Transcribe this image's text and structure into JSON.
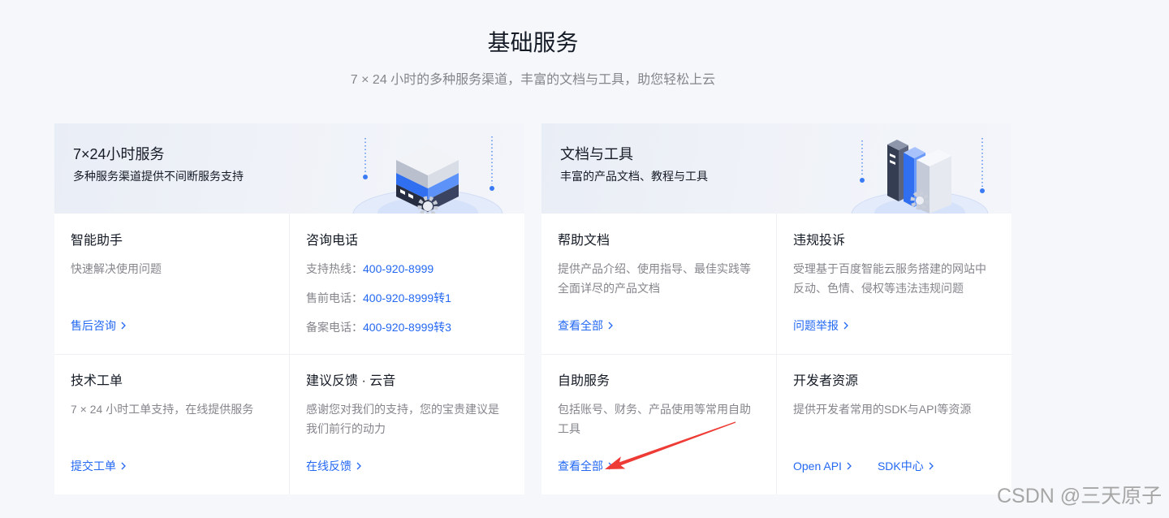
{
  "section": {
    "title": "基础服务",
    "subtitle": "7 × 24 小时的多种服务渠道，丰富的文档与工具，助您轻松上云"
  },
  "panels": [
    {
      "title": "7×24小时服务",
      "subtitle": "多种服务渠道提供不间断服务支持",
      "illustration": "server-stack-illustration",
      "cards": [
        {
          "title": "智能助手",
          "desc": "快速解决使用问题",
          "link": "售后咨询"
        },
        {
          "title": "咨询电话",
          "phones": [
            {
              "label": "支持热线：",
              "number": "400-920-8999"
            },
            {
              "label": "售前电话：",
              "number": "400-920-8999转1"
            },
            {
              "label": "备案电话：",
              "number": "400-920-8999转3"
            }
          ]
        },
        {
          "title": "技术工单",
          "desc": "7 × 24 小时工单支持，在线提供服务",
          "link": "提交工单"
        },
        {
          "title": "建议反馈 · 云音",
          "desc": "感谢您对我们的支持，您的宝贵建议是我们前行的动力",
          "link": "在线反馈"
        }
      ]
    },
    {
      "title": "文档与工具",
      "subtitle": "丰富的产品文档、教程与工具",
      "illustration": "document-tools-illustration",
      "cards": [
        {
          "title": "帮助文档",
          "desc": "提供产品介绍、使用指导、最佳实践等全面详尽的产品文档",
          "link": "查看全部"
        },
        {
          "title": "违规投诉",
          "desc": "受理基于百度智能云服务搭建的网站中反动、色情、侵权等违法违规问题",
          "link": "问题举报"
        },
        {
          "title": "自助服务",
          "desc": "包括账号、财务、产品使用等常用自助工具",
          "link": "查看全部"
        },
        {
          "title": "开发者资源",
          "desc": "提供开发者常用的SDK与API等资源",
          "links": [
            "Open API",
            "SDK中心"
          ]
        }
      ]
    }
  ],
  "icons": {
    "link_suffix": "chevron-right-icon"
  },
  "watermark": "CSDN @三天原子",
  "colors": {
    "text_primary": "#151b26",
    "text_secondary": "#84868c",
    "link": "#2468f2",
    "page_bg": "#f5f7fa",
    "card_bg": "#ffffff",
    "annotation_arrow": "#ee3b35"
  }
}
